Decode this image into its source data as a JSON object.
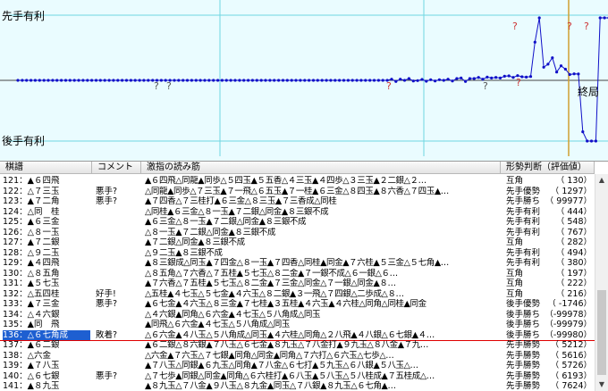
{
  "graph": {
    "top_label": "先手有利",
    "bottom_label": "後手有利",
    "end_label": "終局",
    "bg_color": "#eafcff",
    "line_color": "#0000c8",
    "question_mark": "?",
    "evals": [
      0,
      0,
      0,
      0,
      0,
      0,
      0,
      0,
      0,
      0,
      0,
      0,
      0,
      0,
      0,
      0,
      0,
      0,
      0,
      0,
      0,
      0,
      0,
      0,
      0,
      0,
      0,
      0,
      0,
      0,
      0,
      0,
      0,
      0,
      0,
      0,
      0,
      0,
      0,
      0,
      0,
      0,
      0,
      0,
      0,
      0,
      0,
      0,
      0,
      0,
      0,
      0,
      0,
      0,
      0,
      0,
      0,
      0,
      0,
      0,
      0,
      0,
      0,
      0,
      0,
      0,
      0,
      0,
      0,
      0,
      0,
      0,
      0,
      0,
      0,
      0,
      0,
      0,
      0,
      0,
      0,
      0,
      0,
      0,
      0,
      0,
      40,
      -40,
      40,
      0,
      60,
      -20,
      -10,
      30,
      -30,
      20,
      -20,
      20,
      0,
      40,
      -20,
      60,
      80,
      -40,
      60,
      60,
      100,
      40,
      110,
      80,
      100,
      80,
      140,
      150,
      100,
      160,
      120,
      110,
      130,
      1297,
      99977,
      444,
      548,
      767,
      282,
      494,
      380,
      197,
      222,
      216,
      -1746,
      -99978,
      -99979,
      -99980,
      5212,
      5616,
      5726,
      6193,
      7624
    ]
  },
  "table": {
    "headers": {
      "move": "棋譜",
      "comment": "コメント",
      "line": "激指の読み筋",
      "judge": "形勢判断（評価値）"
    },
    "rows": [
      {
        "move": "121：▲６四飛",
        "comment": "",
        "line": "▲６四飛△同龍▲同歩△５四玉▲５五香△４三玉▲４四歩△３三玉▲２二銀△２…",
        "judge": "互角",
        "value": "（    130）"
      },
      {
        "move": "122：△７三玉",
        "comment": "悪手?",
        "line": "△同龍▲同歩△７三玉▲７一飛△６五玉▲７一桂▲６三金△８四玉▲８六香△７四玉▲…",
        "judge": "先手優勢",
        "value": "（  1297）"
      },
      {
        "move": "123：▲７二角",
        "comment": "悪手?",
        "line": "▲７四香△７三桂打▲６三金△８三玉▲７三香成△同桂",
        "judge": "先手勝ち",
        "value": "（ 99977）"
      },
      {
        "move": "124：△同　桂",
        "comment": "",
        "line": "△同桂▲６三金△８一玉▲７二銀△同金▲８三銀不成",
        "judge": "先手有利",
        "value": "（    444）"
      },
      {
        "move": "125：▲６三金",
        "comment": "",
        "line": "▲６三金△８一玉▲７二銀△同金▲８三銀不成",
        "judge": "先手有利",
        "value": "（    548）"
      },
      {
        "move": "126：△８一玉",
        "comment": "",
        "line": "△８一玉▲７二銀△同金▲８三銀不成",
        "judge": "先手有利",
        "value": "（    767）"
      },
      {
        "move": "127：▲７二銀",
        "comment": "",
        "line": "▲７二銀△同金▲８三銀不成",
        "judge": "互角",
        "value": "（    282）"
      },
      {
        "move": "128：△９二玉",
        "comment": "",
        "line": "△９二玉▲８三銀不成",
        "judge": "先手有利",
        "value": "（    494）"
      },
      {
        "move": "129：▲４四飛",
        "comment": "",
        "line": "▲８三銀成△同玉▲７四金△８一玉▲７四香△同桂▲同金▲７六桂▲５三金△５七角▲…",
        "judge": "先手有利",
        "value": "（    380）"
      },
      {
        "move": "130：△８五角",
        "comment": "",
        "line": "△８五角△７六香△７五桂▲５七玉△８二金▲７一銀不成△６一銀△６…",
        "judge": "互角",
        "value": "（    197）"
      },
      {
        "move": "131：▲５七玉",
        "comment": "",
        "line": "▲７六香△７五桂▲５七玉△８二金▲７三金△同金△７一銀△同金▲８…",
        "judge": "互角",
        "value": "（    222）"
      },
      {
        "move": "132：△五四桂",
        "comment": "好手!",
        "line": "△五桂▲４七玉△５七金▲４六玉△８二銀▲３一飛△７四銀△二歩成△８…",
        "judge": "互角",
        "value": "（    216）"
      },
      {
        "move": "133：▲７三金",
        "comment": "悪手?",
        "line": "▲６七金▲４六玉△８三金▲７七桂▲３五桂▲４六玉▲４六桂△同角△同桂▲同金",
        "judge": "後手優勢",
        "value": "（ -1746）"
      },
      {
        "move": "134：△４六銀",
        "comment": "",
        "line": "△４六銀▲同角△６六金▲４七玉△５八角成△同玉",
        "judge": "後手勝ち",
        "value": "（-99978）"
      },
      {
        "move": "135：▲同　飛",
        "comment": "",
        "line": "▲同飛△６六金▲４七玉△５八角成△同玉",
        "judge": "後手勝ち",
        "value": "（-99979）"
      },
      {
        "move": "136：△６七角成",
        "comment": "敗着?",
        "line": "△６六金▲４八玉△５八角成△同玉▲４六桂△同角△２八飛▲４八銀△６七銀▲４…",
        "judge": "後手勝ち",
        "value": "（-99980）"
      },
      {
        "move": "137：▲６二銀",
        "comment": "",
        "line": "▲６二銀△８六銀▲７八玉△６七金▲８九玉△７八金打▲９九玉△８八金▲７九…",
        "judge": "先手勝勢",
        "value": "（  5212）"
      },
      {
        "move": "138：△六金",
        "comment": "",
        "line": "△六金▲７六玉△７七銀▲同角△同金▲同角△７六打△６六玉△七歩△…",
        "judge": "先手勝勢",
        "value": "（  5616）"
      },
      {
        "move": "139：▲７八玉",
        "comment": "",
        "line": "▲７八玉△同銀▲６九玉△同角▲７八金△６七打▲５九玉△６八銀▲５八玉△…",
        "judge": "先手勝勢",
        "value": "（  5726）"
      },
      {
        "move": "140：△６七銀",
        "comment": "悪手?",
        "line": "△７七歩▲同銀△同金▲同角△６六桂打▲６八玉▲５八玉△５八桂成▲７五桂成△…",
        "judge": "先手勝勢",
        "value": "（  6193）"
      },
      {
        "move": "141：▲８九玉",
        "comment": "",
        "line": "▲８九玉△７八金▲９八玉△８九金▲同玉△７八銀▲８九玉△６七角▲…",
        "judge": "先手勝勢",
        "value": "（  7624）"
      }
    ],
    "selected_index": 15
  }
}
